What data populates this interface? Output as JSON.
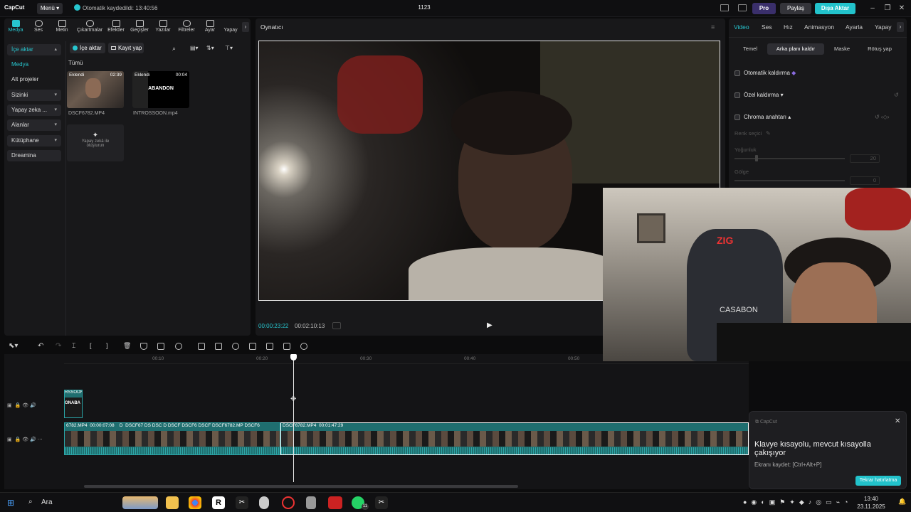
{
  "app": {
    "logo": "CapCut",
    "menu": "Menü",
    "autosave": "Otomatik kaydedildi: 13:40:56",
    "project_name": "1123",
    "pro": "Pro",
    "share": "Paylaş",
    "export": "Dışa Aktar"
  },
  "left_tabs": [
    {
      "label": "Medya"
    },
    {
      "label": "Ses"
    },
    {
      "label": "Metin"
    },
    {
      "label": "Çıkartmalar"
    },
    {
      "label": "Efektler"
    },
    {
      "label": "Geçişler"
    },
    {
      "label": "Yazılar"
    },
    {
      "label": "Filtreler"
    },
    {
      "label": "Ayar"
    },
    {
      "label": "Yapay"
    }
  ],
  "sidebar": {
    "items": [
      {
        "label": "İçe aktar"
      },
      {
        "label": "Medya"
      },
      {
        "label": "Alt projeler"
      },
      {
        "label": "Sizinki"
      },
      {
        "label": "Yapay zeka ..."
      },
      {
        "label": "Alanlar"
      },
      {
        "label": "Kütüphane"
      },
      {
        "label": "Dreamina"
      }
    ]
  },
  "media": {
    "import": "İçe aktar",
    "record": "Kayıt yap",
    "filter_all": "Tümü",
    "items": [
      {
        "badge": "Eklendi",
        "duration": "02:39",
        "name": "DSCF6782.MP4"
      },
      {
        "badge": "Eklendi",
        "duration": "00:04",
        "name": "INTROSSOON.mp4",
        "thumb_text": "ABANDON"
      }
    ],
    "ai_create": "Yapay zekâ ile oluşturun"
  },
  "player": {
    "title": "Oynatıcı",
    "current_time": "00:00:23:22",
    "total_time": "00:02:10:13"
  },
  "right_panel": {
    "tabs": [
      "Video",
      "Ses",
      "Hız",
      "Animasyon",
      "Ayarla",
      "Yapay"
    ],
    "subtabs": [
      "Temel",
      "Arka planı kaldır",
      "Maske",
      "Rötuş yap"
    ],
    "options": {
      "auto_remove": "Otomatik kaldırma",
      "custom_remove": "Özel kaldırma",
      "chroma_key": "Chroma anahtarı",
      "color_picker": "Renk seçici",
      "intensity": "Yoğunluk",
      "intensity_value": "20",
      "shadow": "Gölge",
      "shadow_value": "0"
    }
  },
  "timeline": {
    "ticks": [
      "00:10",
      "00:20",
      "00:30",
      "00:40",
      "00:50"
    ],
    "intro_clip": [
      "RSSOON.",
      "ONABA"
    ],
    "main_clip_labels": [
      "6782.MP4",
      "00:00:07:08",
      "D",
      "DSCF67",
      "DS",
      "DSC",
      "D",
      "DSCF",
      "DSCF6",
      "DSCF",
      "DSCF6782.MP",
      "DSCF6"
    ],
    "selected_clip": {
      "name": "DSCF6782.MP4",
      "duration": "00:01:47:29"
    }
  },
  "toast": {
    "app": "CapCut",
    "title": "Klavye kısayolu, mevcut kısayolla çakışıyor",
    "subtitle": "Ekranı kaydet: [Ctrl+Alt+P]",
    "button": "Tekrar hatırlatma"
  },
  "taskbar": {
    "search": "Ara",
    "time": "13:40",
    "date": "23.11.2025",
    "badge": "11"
  },
  "webcam": {
    "chair_text": "ZIG",
    "chair_text2": "CASABON"
  }
}
